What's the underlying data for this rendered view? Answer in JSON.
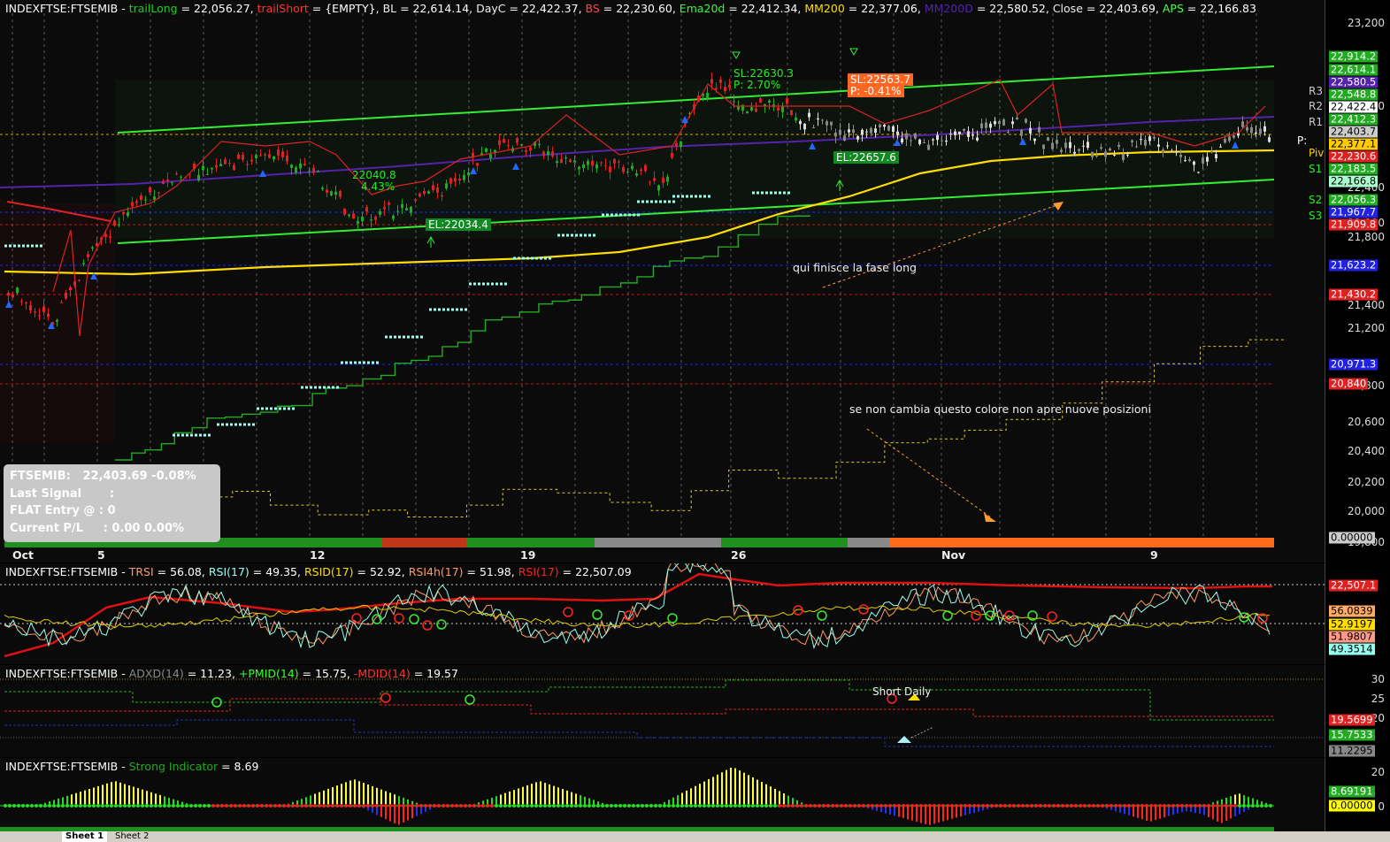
{
  "main_header": {
    "symbol": "INDEXFTSE:FTSEMIB -",
    "items": [
      {
        "name": "trailLong",
        "value": " = 22,056.27,",
        "color": "#22cc22"
      },
      {
        "name": "trailShort",
        "value": " = {EMPTY},",
        "color": "#ff3333"
      },
      {
        "name": "BL",
        "value": " = 22,614.14,",
        "color": "#eeeeee"
      },
      {
        "name": "DayC",
        "value": " = 22,422.37,",
        "color": "#eeeeee"
      },
      {
        "name": "BS",
        "value": " = 22,230.60,",
        "color": "#ff4444"
      },
      {
        "name": "Ema20d",
        "value": " = 22,412.34,",
        "color": "#33ff33"
      },
      {
        "name": "MM200",
        "value": " = 22,377.06,",
        "color": "#ffdd00"
      },
      {
        "name": "MM200D",
        "value": " = 22,580.52,",
        "color": "#5522aa"
      },
      {
        "name": "Close",
        "value": " = 22,403.69,",
        "color": "#eeeeee"
      },
      {
        "name": "APS",
        "value": " = 22,166.83",
        "color": "#44ff44"
      }
    ]
  },
  "price_axis": [
    "23,200",
    "22,800",
    "22,400",
    "22,000",
    "21,800",
    "21,400",
    "21,200",
    "20,800",
    "20,600",
    "20,400",
    "20,200",
    "20,000",
    "19,800"
  ],
  "price_labels": [
    {
      "text": "22,914.2",
      "bg": "#22aa22",
      "fg": "#fff"
    },
    {
      "text": "22,614.1",
      "bg": "#22aa22",
      "fg": "#fff"
    },
    {
      "text": "22,580.5",
      "bg": "#5522aa",
      "fg": "#fff"
    },
    {
      "text": "22,548.8",
      "bg": "#22aa22",
      "fg": "#fff"
    },
    {
      "text": "22,422.4",
      "bg": "#ffffff",
      "fg": "#000"
    },
    {
      "text": "22,412.3",
      "bg": "#22aa22",
      "fg": "#fff"
    },
    {
      "text": "22,403.7",
      "bg": "#cccccc",
      "fg": "#000"
    },
    {
      "text": "22,377.1",
      "bg": "#ffcc00",
      "fg": "#000"
    },
    {
      "text": "22,230.6",
      "bg": "#dd2222",
      "fg": "#fff"
    },
    {
      "text": "22,183.5",
      "bg": "#22aa22",
      "fg": "#fff"
    },
    {
      "text": "22,166.8",
      "bg": "#aaffcc",
      "fg": "#000"
    },
    {
      "text": "22,056.3",
      "bg": "#22aa22",
      "fg": "#fff"
    },
    {
      "text": "21,967.7",
      "bg": "#2222dd",
      "fg": "#fff"
    },
    {
      "text": "21,909.8",
      "bg": "#dd2222",
      "fg": "#fff"
    },
    {
      "text": "21,623.2",
      "bg": "#2222dd",
      "fg": "#fff"
    },
    {
      "text": "21,430.2",
      "bg": "#dd2222",
      "fg": "#fff"
    },
    {
      "text": "20,971.3",
      "bg": "#2222dd",
      "fg": "#fff"
    },
    {
      "text": "20,840",
      "bg": "#dd2222",
      "fg": "#fff"
    },
    {
      "text": "0.00000",
      "bg": "#cccccc",
      "fg": "#000"
    }
  ],
  "pivots": {
    "R3": "R3",
    "R2": "R2",
    "R1": "R1",
    "P": "P:",
    "Piv": "Piv",
    "S1": "S1",
    "S2": "S2",
    "S3": "S3"
  },
  "x_dates": [
    "Oct",
    "5",
    "12",
    "19",
    "26",
    "Nov",
    "9"
  ],
  "annotations": {
    "fine_long": "qui finisce la fase long",
    "colore": "se non cambia questo colore non apre nuove posizioni",
    "short_daily": "Short Daily"
  },
  "tags": {
    "sl1": "SL:22630.3",
    "p1": "P:   2.70%",
    "sl2": "SL:22563.7",
    "p2": "P:  -0.41%",
    "el1": "EL:22034.4",
    "el2": "EL:22657.6",
    "sl3": "22040.8",
    "p3": "4.43%"
  },
  "infobox": {
    "line1": "FTSEMIB:   22,403.69 -0.08%",
    "line2": "Last Signal       :",
    "line3": "FLAT Entry @ : 0",
    "line4": "Current P/L     : 0.00 0.00%"
  },
  "rsi_header": {
    "symbol": "INDEXFTSE:FTSEMIB -",
    "items": [
      {
        "name": "TRSI",
        "value": " = 56.08,",
        "color": "#ff9966"
      },
      {
        "name": "RSI(17)",
        "value": " = 49.35,",
        "color": "#99ffee"
      },
      {
        "name": "RSID(17)",
        "value": " = 52.92,",
        "color": "#ffdd00"
      },
      {
        "name": "RSI4h(17)",
        "value": " = 51.98,",
        "color": "#ff9966"
      },
      {
        "name": "RSI(17)",
        "value": " = 22,507.09",
        "color": "#ff2222"
      }
    ],
    "labels": [
      {
        "text": "22,507.1",
        "bg": "#dd2222",
        "fg": "#fff"
      },
      {
        "text": "56.0839",
        "bg": "#ffaa66",
        "fg": "#000"
      },
      {
        "text": "52.9197",
        "bg": "#ffdd00",
        "fg": "#000"
      },
      {
        "text": "51.9807",
        "bg": "#ff9988",
        "fg": "#000"
      },
      {
        "text": "49.3514",
        "bg": "#99ffee",
        "fg": "#000"
      }
    ]
  },
  "adx_header": {
    "symbol": "INDEXFTSE:FTSEMIB -",
    "items": [
      {
        "name": "ADXD(14)",
        "value": " = 11.23,",
        "color": "#888888"
      },
      {
        "name": "+PMID(14)",
        "value": " = 15.75,",
        "color": "#33ff33"
      },
      {
        "name": "-MDID(14)",
        "value": " = 19.57",
        "color": "#ff3333"
      }
    ],
    "axis": [
      "30",
      "25",
      "20"
    ],
    "labels": [
      {
        "text": "19.5699",
        "bg": "#dd2222",
        "fg": "#fff"
      },
      {
        "text": "15.7533",
        "bg": "#22aa22",
        "fg": "#fff"
      },
      {
        "text": "11.2295",
        "bg": "#888888",
        "fg": "#000"
      }
    ]
  },
  "strong_header": {
    "symbol": "INDEXFTSE:FTSEMIB -",
    "items": [
      {
        "name": "Strong Indicator",
        "value": " = 8.69",
        "color": "#22aa22"
      }
    ],
    "axis": [
      "20",
      "0"
    ],
    "labels": [
      {
        "text": "8.69191",
        "bg": "#22aa22",
        "fg": "#fff"
      },
      {
        "text": "0.00000",
        "bg": "#ffff00",
        "fg": "#000"
      }
    ]
  },
  "status": {
    "sheet1": "Sheet 1",
    "sheet2": "Sheet 2"
  },
  "colors": {
    "background": "#000000",
    "grid": "#999999",
    "bullish": "#22aa22",
    "bearish": "#dd2222",
    "ema200": "#ffdd00",
    "channel": "#33ee33"
  }
}
